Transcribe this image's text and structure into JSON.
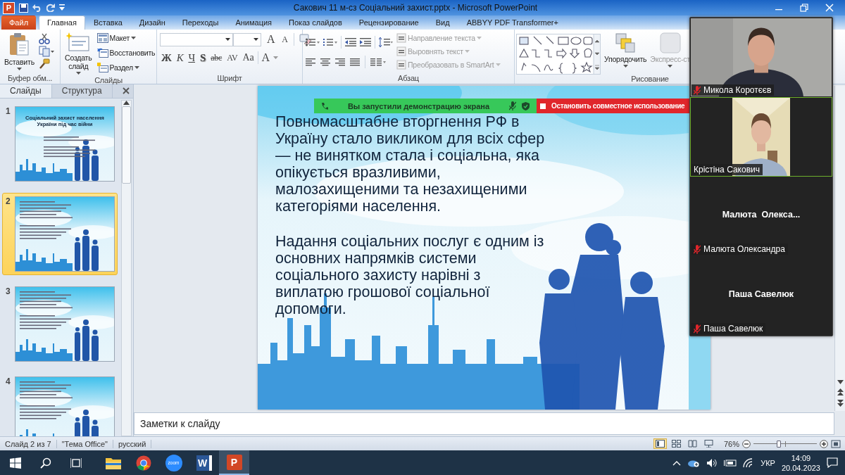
{
  "window": {
    "app_glyph": "P",
    "title": "Сакович 11 м-сз Соціальний захист.pptx - Microsoft PowerPoint"
  },
  "ribbon_tabs": [
    {
      "label": "Файл",
      "kind": "file",
      "selected": false
    },
    {
      "label": "Главная",
      "kind": "tab",
      "selected": true
    },
    {
      "label": "Вставка",
      "kind": "tab",
      "selected": false
    },
    {
      "label": "Дизайн",
      "kind": "tab",
      "selected": false
    },
    {
      "label": "Переходы",
      "kind": "tab",
      "selected": false
    },
    {
      "label": "Анимация",
      "kind": "tab",
      "selected": false
    },
    {
      "label": "Показ слайдов",
      "kind": "tab",
      "selected": false
    },
    {
      "label": "Рецензирование",
      "kind": "tab",
      "selected": false
    },
    {
      "label": "Вид",
      "kind": "tab",
      "selected": false
    },
    {
      "label": "ABBYY PDF Transformer+",
      "kind": "tab",
      "selected": false
    }
  ],
  "clipboard_group": {
    "paste": "Вставить",
    "label": "Буфер обм..."
  },
  "slides_group": {
    "new_slide": "Создать слайд",
    "layout": "Макет",
    "reset": "Восстановить",
    "section": "Раздел",
    "label": "Слайды"
  },
  "font_group": {
    "grow": "A",
    "shrink": "A",
    "buttons": [
      "Ж",
      "К",
      "Ч",
      "S",
      "abc",
      "AV",
      "Aa"
    ],
    "font_color": "A",
    "label": "Шрифт"
  },
  "paragraph_group": {
    "commands": [
      {
        "label": "Направление текста",
        "disabled": true
      },
      {
        "label": "Выровнять текст",
        "disabled": true
      },
      {
        "label": "Преобразовать в SmartArt",
        "disabled": true
      }
    ],
    "label": "Абзац"
  },
  "drawing_group": {
    "arrange": {
      "label": "Упорядочить",
      "disabled": false
    },
    "quick_styles": {
      "label": "Экспресс-ст",
      "disabled": true
    },
    "label": "Рисование"
  },
  "side_panel": {
    "tabs": [
      {
        "label": "Слайды",
        "selected": true
      },
      {
        "label": "Структура",
        "selected": false
      }
    ],
    "thumbnails": [
      {
        "number": "1",
        "selected": false,
        "title": "Соціальний захист населення України під час війни"
      },
      {
        "number": "2",
        "selected": true
      },
      {
        "number": "3",
        "selected": false
      },
      {
        "number": "4",
        "selected": false
      }
    ]
  },
  "slide": {
    "paragraphs": [
      "Повномасштабне вторгнення РФ в Україну стало викликом для всіх сфер — не винятком стала і соціальна, яка опікується вразливими, малозахищеними та незахищеними категоріями населення.",
      "Надання соціальних послуг є одним із основних напрямків системи соціального захисту нарівні з виплатою грошової соціальної допомоги."
    ]
  },
  "notes": {
    "placeholder": "Заметки к слайду"
  },
  "status_bar": {
    "slide": "Слайд 2 из 7",
    "theme": "\"Тема Office\"",
    "language": "русский",
    "view_buttons": [
      {
        "selected": true
      },
      {
        "selected": false
      },
      {
        "selected": false
      },
      {
        "selected": false
      }
    ],
    "zoom": "76%",
    "zoom_slider": {
      "level": 0.4
    }
  },
  "taskbar": {
    "apps": [
      {
        "kind": "explorer",
        "selected": false
      },
      {
        "kind": "chrome",
        "selected": false
      },
      {
        "kind": "zoom",
        "glyph": "zoom",
        "selected": false
      },
      {
        "kind": "word",
        "glyph": "W",
        "selected": false
      },
      {
        "kind": "powerpoint",
        "glyph": "P",
        "selected": true
      }
    ],
    "language": "УКР",
    "time": "14:09",
    "date": "20.04.2023"
  },
  "share_banner": {
    "status": "Вы запустили демонстрацию экрана",
    "stop_button": "Остановить совместное использование"
  },
  "video_panel": {
    "tiles": [
      {
        "kind": "video",
        "name": "Микола Коротєєв",
        "muted": true,
        "active": false
      },
      {
        "kind": "portrait_video",
        "name": "Крістіна Сакович",
        "muted": false,
        "active": true
      },
      {
        "kind": "no_video",
        "display_name": "Малюта  Олекса...",
        "name": "Малюта Олександра",
        "muted": true,
        "active": false
      },
      {
        "kind": "no_video",
        "display_name": "Паша Савелюк",
        "name": "Паша Савелюк",
        "muted": true,
        "active": false
      }
    ]
  }
}
